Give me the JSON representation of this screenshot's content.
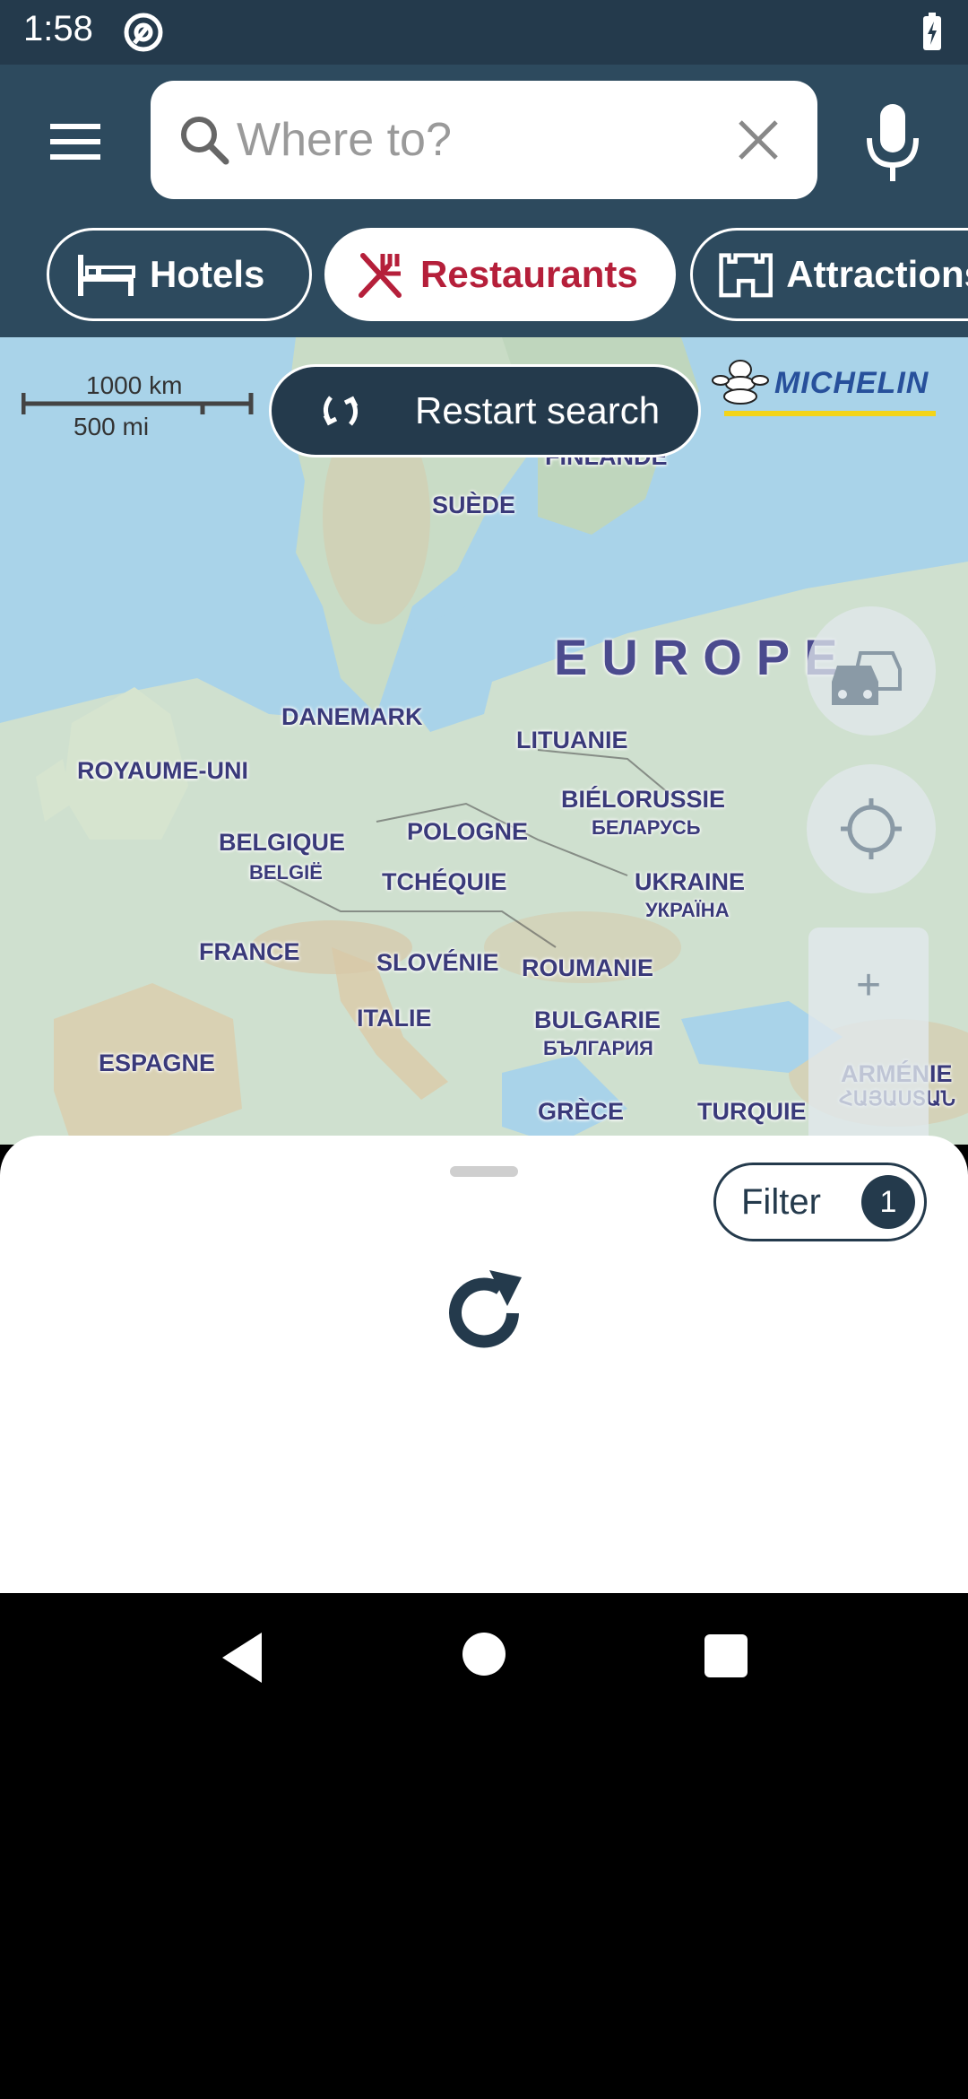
{
  "status_bar": {
    "time": "1:58"
  },
  "header": {
    "search": {
      "placeholder": "Where to?",
      "value": ""
    },
    "chips": [
      {
        "label": "Hotels",
        "icon": "bed-icon",
        "selected": false
      },
      {
        "label": "Restaurants",
        "icon": "fork-knife-icon",
        "selected": true
      },
      {
        "label": "Attractions",
        "icon": "castle-icon",
        "selected": false
      }
    ]
  },
  "map": {
    "scale_top": "1000 km",
    "scale_bottom": "500 mi",
    "restart_label": "Restart search",
    "brand": "MICHELIN",
    "labels": [
      {
        "text": "FINLANDE"
      },
      {
        "text": "SUÈDE"
      },
      {
        "text": "EUROPE"
      },
      {
        "text": "DANEMARK"
      },
      {
        "text": "LITUANIE"
      },
      {
        "text": "ROYAUME-UNI"
      },
      {
        "text": "BIÉLORUSSIE"
      },
      {
        "text": "БЕЛАРУСЬ"
      },
      {
        "text": "POLOGNE"
      },
      {
        "text": "BELGIQUE"
      },
      {
        "text": "BELGIË"
      },
      {
        "text": "TCHÉQUIE"
      },
      {
        "text": "UKRAINE"
      },
      {
        "text": "УКРАЇНА"
      },
      {
        "text": "FRANCE"
      },
      {
        "text": "SLOVÉNIE"
      },
      {
        "text": "ROUMANIE"
      },
      {
        "text": "ITALIE"
      },
      {
        "text": "BULGARIE"
      },
      {
        "text": "БЪЛГАРИЯ"
      },
      {
        "text": "ESPAGNE"
      },
      {
        "text": "GRÈCE"
      },
      {
        "text": "TURQUIE"
      },
      {
        "text": "ARMÉNIE"
      },
      {
        "text": "ՀԱՅԱՍՏԱՆ"
      }
    ],
    "zoom_in": "+"
  },
  "sheet": {
    "filter_label": "Filter",
    "filter_count": "1"
  },
  "colors": {
    "header": "#2d4a5e",
    "status_bar": "#243a4c",
    "accent_red": "#b51f3a",
    "sea": "#a9d3e9",
    "land": "#cfe0cf"
  }
}
